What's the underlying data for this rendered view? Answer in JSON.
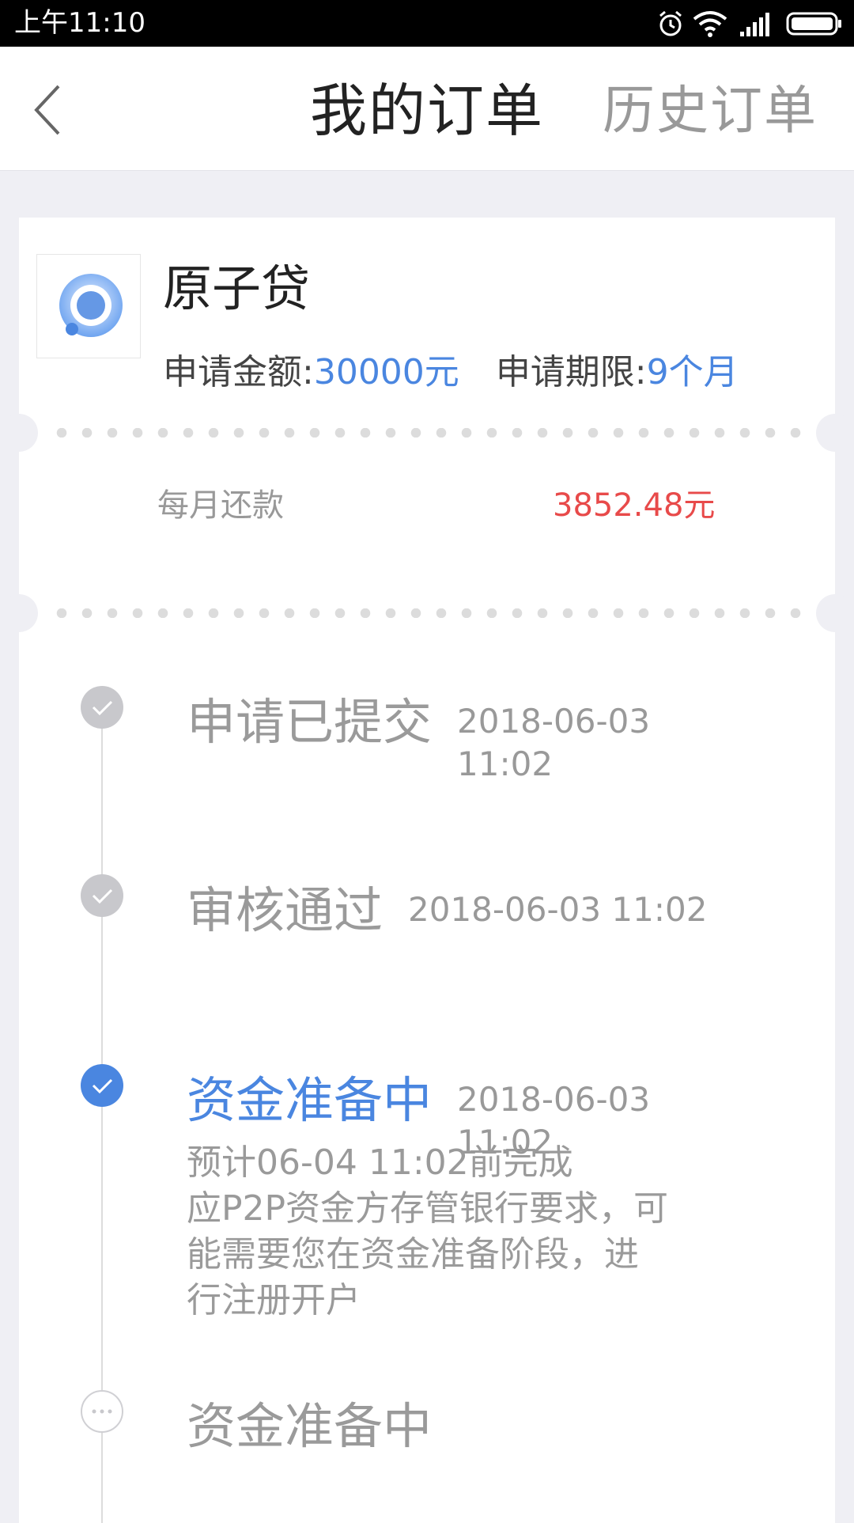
{
  "status_bar": {
    "time": "上午11:10",
    "icons": [
      "alarm-icon",
      "wifi-icon",
      "signal-icon",
      "battery-icon"
    ]
  },
  "nav": {
    "title": "我的订单",
    "history": "历史订单",
    "back_icon": "chevron-left-icon"
  },
  "product": {
    "name": "原子贷",
    "amount_label": "申请金额:",
    "amount_value": "30000元",
    "term_label": "申请期限:",
    "term_value": "9个月"
  },
  "repayment": {
    "label": "每月还款",
    "value": "3852.48元"
  },
  "steps": [
    {
      "title": "申请已提交",
      "time_line1": "2018-06-03",
      "time_line2": "11:02",
      "state": "done"
    },
    {
      "title": "审核通过",
      "time": "2018-06-03 11:02",
      "state": "done"
    },
    {
      "title": "资金准备中",
      "time_line1": "2018-06-03",
      "time_line2": "11:02",
      "state": "active",
      "desc": [
        "预计06-04 11:02前完成",
        "应P2P资金方存管银行要求，可",
        "能需要您在资金准备阶段，进",
        "行注册开户"
      ]
    },
    {
      "title": "资金准备中",
      "state": "pending"
    }
  ],
  "colors": {
    "accent": "#4a86e0",
    "amount_red": "#e84a4a",
    "background": "#efeff4"
  }
}
